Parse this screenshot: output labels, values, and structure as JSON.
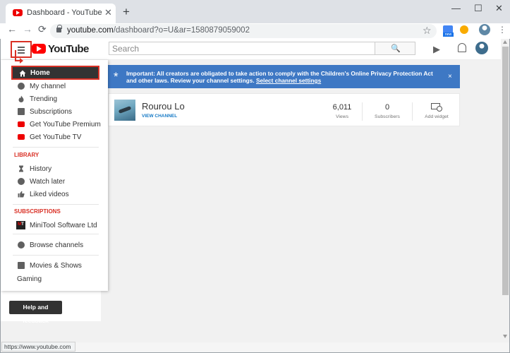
{
  "browser": {
    "tab_title": "Dashboard - YouTube",
    "tab_close": "✕",
    "new_tab": "+",
    "window_controls": [
      "—",
      "☐",
      "✕"
    ],
    "nav": [
      "←",
      "→",
      "⟳"
    ],
    "url_host": "youtube.com",
    "url_path": "/dashboard?o=U&ar=1580879059002",
    "bookmark_star": "☆",
    "extension_badge": "new",
    "menu": "⋮",
    "status_url": "https://www.youtube.com"
  },
  "header": {
    "logo_text": "YouTube",
    "search_placeholder": "Search",
    "search_icon": "🔍",
    "camera_icon": "▶"
  },
  "sidebar": {
    "items": [
      {
        "label": "Home",
        "icon": "home-icon"
      },
      {
        "label": "My channel",
        "icon": "person-icon"
      },
      {
        "label": "Trending",
        "icon": "flame-icon"
      },
      {
        "label": "Subscriptions",
        "icon": "subscriptions-icon"
      },
      {
        "label": "Get YouTube Premium",
        "icon": "youtube-icon"
      },
      {
        "label": "Get YouTube TV",
        "icon": "youtube-tv-icon"
      }
    ],
    "library_title": "LIBRARY",
    "library": [
      {
        "label": "History",
        "icon": "hourglass-icon"
      },
      {
        "label": "Watch later",
        "icon": "clock-icon"
      },
      {
        "label": "Liked videos",
        "icon": "thumbs-up-icon"
      }
    ],
    "subscriptions_title": "SUBSCRIPTIONS",
    "subscriptions": [
      {
        "label": "MiniTool Software Ltd",
        "icon": "minitool-logo"
      }
    ],
    "browse": {
      "label": "Browse channels",
      "icon": "plus-circle-icon"
    },
    "movies": {
      "label": "Movies & Shows",
      "icon": "film-icon"
    },
    "gaming": "Gaming",
    "minitool_letters": [
      "M",
      "T"
    ]
  },
  "help_button": "Help and feedback",
  "banner": {
    "star": "*",
    "text": "Important: All creators are obligated to take action to comply with the Children's Online Privacy Protection Act and other laws. Review your channel settings.",
    "link": "Select channel settings",
    "close": "×"
  },
  "channel": {
    "name": "Rourou Lo",
    "view_channel": "VIEW CHANNEL",
    "views_value": "6,011",
    "views_label": "Views",
    "subscribers_value": "0",
    "subscribers_label": "Subscribers",
    "add_widget_label": "Add widget"
  }
}
